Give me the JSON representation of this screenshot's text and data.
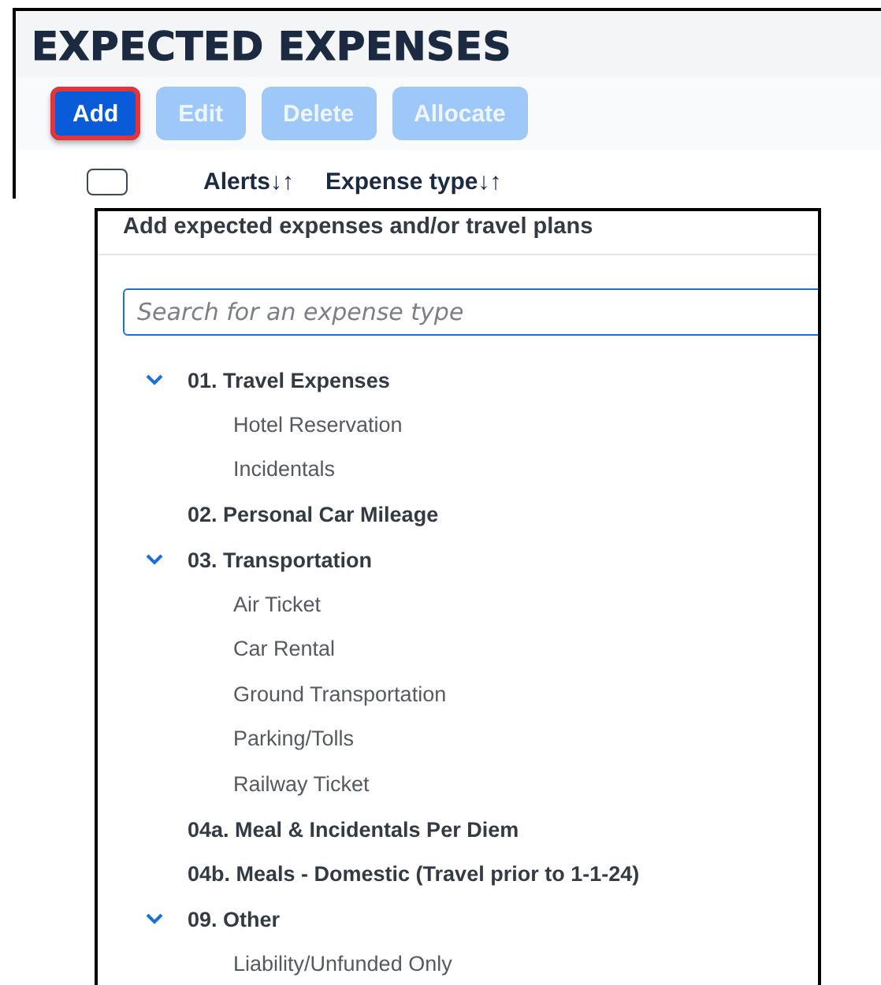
{
  "panel": {
    "title": "EXPECTED EXPENSES",
    "buttons": [
      {
        "label": "Add",
        "disabled": false,
        "highlighted": true
      },
      {
        "label": "Edit",
        "disabled": true,
        "highlighted": false
      },
      {
        "label": "Delete",
        "disabled": true,
        "highlighted": false
      },
      {
        "label": "Allocate",
        "disabled": true,
        "highlighted": false
      }
    ],
    "table": {
      "select_all": {
        "checked": false
      },
      "columns": [
        "Alerts↓↑",
        "Expense type↓↑"
      ]
    }
  },
  "dropdown": {
    "title": "Add expected expenses and/or travel plans",
    "search": {
      "placeholder": "Search for an expense type"
    },
    "categories": [
      {
        "label": "01. Travel Expenses",
        "expanded": true,
        "children": [
          "Hotel Reservation",
          "Incidentals"
        ]
      },
      {
        "label": "02. Personal Car Mileage"
      },
      {
        "label": "03. Transportation",
        "expanded": true,
        "children": [
          "Air Ticket",
          "Car Rental",
          "Ground Transportation",
          "Parking/Tolls",
          "Railway Ticket"
        ]
      },
      {
        "label": "04a. Meal & Incidentals Per Diem"
      },
      {
        "label": "04b. Meals - Domestic (Travel prior to 1-1-24)"
      },
      {
        "label": "09. Other",
        "expanded": true,
        "children": [
          "Liability/Unfunded Only"
        ]
      }
    ]
  }
}
